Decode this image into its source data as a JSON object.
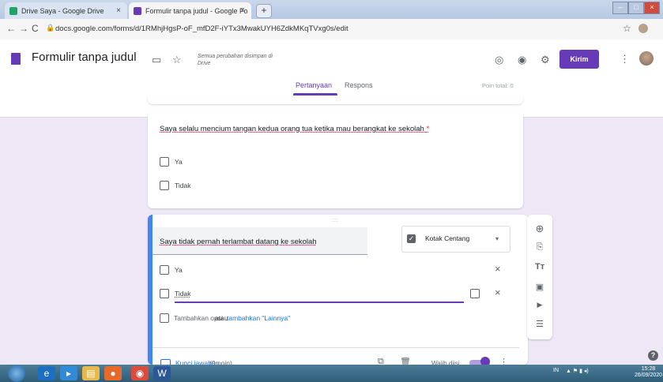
{
  "browser": {
    "tabs": [
      {
        "title": "Drive Saya - Google Drive",
        "close": "×",
        "favicon_color": "#1fa463"
      },
      {
        "title": "Formulir tanpa judul - Google Fo",
        "close": "×",
        "favicon_color": "#673ab7"
      }
    ],
    "new_tab": "+",
    "url": "docs.google.com/forms/d/1RMhjHgsP-oF_mfD2F-iYTx3MwakUYH6ZdkMKqTVxg0s/edit",
    "window_controls": [
      "–",
      "□",
      "×"
    ],
    "back": "←",
    "forward": "→",
    "reload": "C",
    "star": "☆"
  },
  "header": {
    "title": "Formulir tanpa judul",
    "saved_message": "Semua perubahan disimpan di Drive",
    "send_label": "Kirim",
    "more": "⋮",
    "accent_color": "#673ab7"
  },
  "tabs": {
    "questions": "Pertanyaan",
    "responses": "Respons",
    "points_total": "Poin total: 0"
  },
  "question1": {
    "text": "Saya selalu mencium tangan kedua orang tua ketika mau berangkat ke sekolah",
    "required_mark": "*",
    "options": [
      "Ya",
      "Tidak"
    ]
  },
  "question2": {
    "drag_handle": ":::",
    "text": "Saya tidak pernah terlambat datang ke sekolah",
    "type_label": "Kotak Centang",
    "type_check": "✓",
    "dropdown_arrow": "▾",
    "options": [
      "Ya",
      "Tidak"
    ],
    "remove": "×",
    "add_option": "Tambahkan opsi",
    "or": "atau",
    "add_other": "tambahkan \"Lainnya\"",
    "answer_key": "Kunci jawaban",
    "answer_key_points": "(0 poin)",
    "required_label": "Wajib diisi"
  },
  "sidebar": {
    "add_question": "⊕",
    "import": "⎘",
    "title": "Tт",
    "image": "▣",
    "video": "▶",
    "section": "☰"
  },
  "help": "?",
  "taskbar": {
    "tray_text": "IN",
    "time": "15:28",
    "date": "26/09/2020"
  }
}
